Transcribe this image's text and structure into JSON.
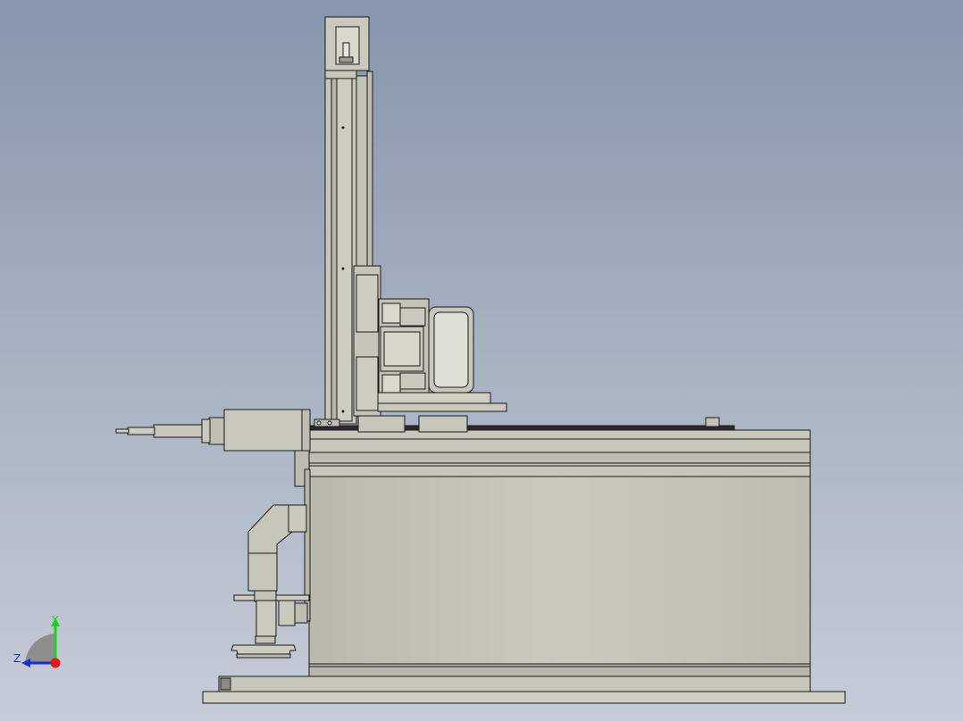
{
  "viewport": {
    "background_top": "#8796ab",
    "background_bottom": "#c6ccd7"
  },
  "model": {
    "part_fill": "#c3c3b8",
    "part_fill_light": "#d3d3c8",
    "edge_color": "#1a1a1a",
    "dark_strip": "#2b2b2b"
  },
  "triad": {
    "y_label": "Y",
    "z_label": "Z",
    "y_color": "#1fd01f",
    "z_color": "#1a2fd8",
    "origin_color": "#e01818",
    "arc_color": "#8e8e8e"
  }
}
